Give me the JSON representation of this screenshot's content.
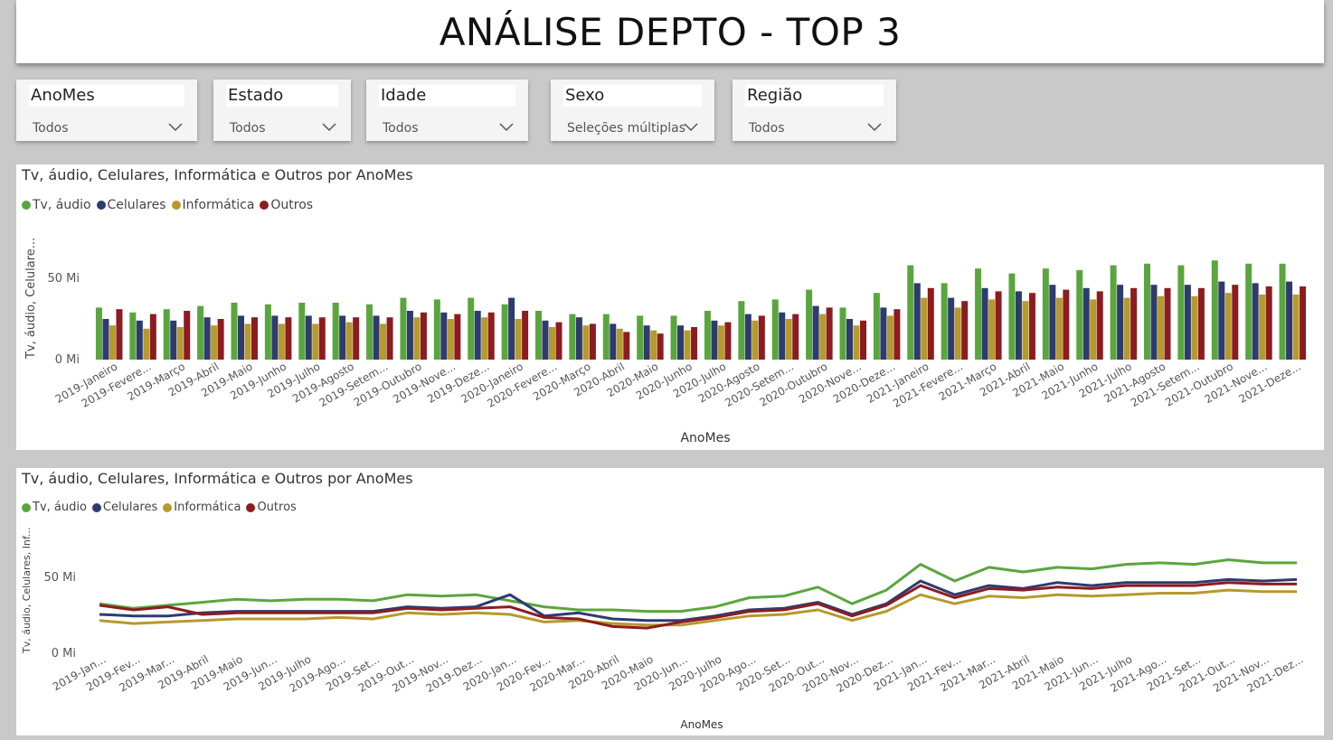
{
  "header": {
    "title": "ANÁLISE DEPTO - TOP 3"
  },
  "slicers": [
    {
      "title": "AnoMes",
      "value": "Todos"
    },
    {
      "title": "Estado",
      "value": "Todos"
    },
    {
      "title": "Idade",
      "value": "Todos"
    },
    {
      "title": "Sexo",
      "value": "Seleções múltiplas"
    },
    {
      "title": "Região",
      "value": "Todos"
    }
  ],
  "colors": {
    "tv": "#5aa63e",
    "cel": "#2e3b6f",
    "info": "#b59a2d",
    "outros": "#8c1c20"
  },
  "bar_chart": {
    "title": "Tv, áudio, Celulares, Informática e Outros por AnoMes",
    "ylabel": "Tv, áudio, Celulare...",
    "xlabel": "AnoMes",
    "ytick_labels": [
      "0 Mi",
      "50 Mi"
    ],
    "xtick_labels": [
      "2019-Janeiro",
      "2019-Fevere...",
      "2019-Março",
      "2019-Abril",
      "2019-Maio",
      "2019-Junho",
      "2019-Julho",
      "2019-Agosto",
      "2019-Setem...",
      "2019-Outubro",
      "2019-Nove...",
      "2019-Deze...",
      "2020-Janeiro",
      "2020-Fevere...",
      "2020-Março",
      "2020-Abril",
      "2020-Maio",
      "2020-Junho",
      "2020-Julho",
      "2020-Agosto",
      "2020-Setem...",
      "2020-Outubro",
      "2020-Nove...",
      "2020-Deze...",
      "2021-Janeiro",
      "2021-Fevere...",
      "2021-Março",
      "2021-Abril",
      "2021-Maio",
      "2021-Junho",
      "2021-Julho",
      "2021-Agosto",
      "2021-Setem...",
      "2021-Outubro",
      "2021-Nove...",
      "2021-Deze..."
    ]
  },
  "line_chart": {
    "title": "Tv, áudio, Celulares, Informática e Outros por AnoMes",
    "ylabel": "Tv, áudio, Celulares, Inf...",
    "xlabel": "AnoMes",
    "ytick_labels": [
      "0 Mi",
      "50 Mi"
    ],
    "xtick_labels": [
      "2019-Jan...",
      "2019-Fev...",
      "2019-Mar...",
      "2019-Abril",
      "2019-Maio",
      "2019-Jun...",
      "2019-Julho",
      "2019-Ago...",
      "2019-Set...",
      "2019-Out...",
      "2019-Nov...",
      "2019-Dez...",
      "2020-Jan...",
      "2020-Fev...",
      "2020-Mar...",
      "2020-Abril",
      "2020-Maio",
      "2020-Jun...",
      "2020-Julho",
      "2020-Ago...",
      "2020-Set...",
      "2020-Out...",
      "2020-Nov...",
      "2020-Dez...",
      "2021-Jan...",
      "2021-Fev...",
      "2021-Mar...",
      "2021-Abril",
      "2021-Maio",
      "2021-Jun...",
      "2021-Julho",
      "2021-Ago...",
      "2021-Set...",
      "2021-Out...",
      "2021-Nov...",
      "2021-Dez..."
    ]
  },
  "chart_data": {
    "type": "bar",
    "categories": [
      "2019-Janeiro",
      "2019-Fevereiro",
      "2019-Março",
      "2019-Abril",
      "2019-Maio",
      "2019-Junho",
      "2019-Julho",
      "2019-Agosto",
      "2019-Setembro",
      "2019-Outubro",
      "2019-Novembro",
      "2019-Dezembro",
      "2020-Janeiro",
      "2020-Fevereiro",
      "2020-Março",
      "2020-Abril",
      "2020-Maio",
      "2020-Junho",
      "2020-Julho",
      "2020-Agosto",
      "2020-Setembro",
      "2020-Outubro",
      "2020-Novembro",
      "2020-Dezembro",
      "2021-Janeiro",
      "2021-Fevereiro",
      "2021-Março",
      "2021-Abril",
      "2021-Maio",
      "2021-Junho",
      "2021-Julho",
      "2021-Agosto",
      "2021-Setembro",
      "2021-Outubro",
      "2021-Novembro",
      "2021-Dezembro"
    ],
    "ylim": [
      0,
      65
    ],
    "series": [
      {
        "name": "Tv, áudio",
        "values": [
          32,
          29,
          31,
          33,
          35,
          34,
          35,
          35,
          34,
          38,
          37,
          38,
          34,
          30,
          28,
          28,
          27,
          27,
          30,
          36,
          37,
          43,
          32,
          41,
          58,
          47,
          56,
          53,
          56,
          55,
          58,
          59,
          58,
          61,
          59,
          59
        ]
      },
      {
        "name": "Celulares",
        "values": [
          25,
          24,
          24,
          26,
          27,
          27,
          27,
          27,
          27,
          30,
          29,
          30,
          38,
          24,
          26,
          22,
          21,
          21,
          24,
          28,
          29,
          33,
          25,
          32,
          47,
          38,
          44,
          42,
          46,
          44,
          46,
          46,
          46,
          48,
          47,
          48
        ]
      },
      {
        "name": "Informática",
        "values": [
          21,
          19,
          20,
          21,
          22,
          22,
          22,
          23,
          22,
          26,
          25,
          26,
          25,
          20,
          21,
          19,
          18,
          18,
          21,
          24,
          25,
          28,
          21,
          27,
          38,
          32,
          37,
          36,
          38,
          37,
          38,
          39,
          39,
          41,
          40,
          40
        ]
      },
      {
        "name": "Outros",
        "values": [
          31,
          28,
          30,
          25,
          26,
          26,
          26,
          26,
          26,
          29,
          28,
          29,
          30,
          23,
          22,
          17,
          16,
          20,
          23,
          27,
          28,
          32,
          24,
          31,
          44,
          36,
          42,
          41,
          43,
          42,
          44,
          44,
          44,
          46,
          45,
          45
        ]
      }
    ]
  }
}
